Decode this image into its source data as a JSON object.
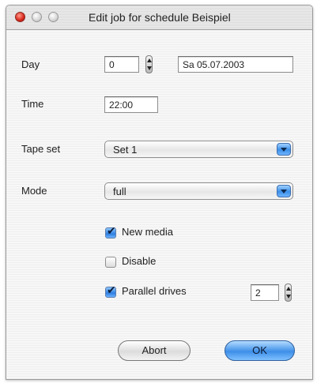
{
  "window": {
    "title": "Edit job for schedule Beispiel"
  },
  "form": {
    "day": {
      "label": "Day",
      "value": "0",
      "date": "Sa 05.07.2003"
    },
    "time": {
      "label": "Time",
      "value": "22:00"
    },
    "tape_set": {
      "label": "Tape set",
      "selected": "Set 1"
    },
    "mode": {
      "label": "Mode",
      "selected": "full"
    },
    "new_media": {
      "label": "New media",
      "checked": true
    },
    "disable": {
      "label": "Disable",
      "checked": false
    },
    "parallel_drives": {
      "label": "Parallel drives",
      "checked": true,
      "value": "2"
    }
  },
  "buttons": {
    "abort": "Abort",
    "ok": "OK"
  },
  "colors": {
    "accent": "#3d8ee8",
    "close_light": "#d7261b"
  }
}
